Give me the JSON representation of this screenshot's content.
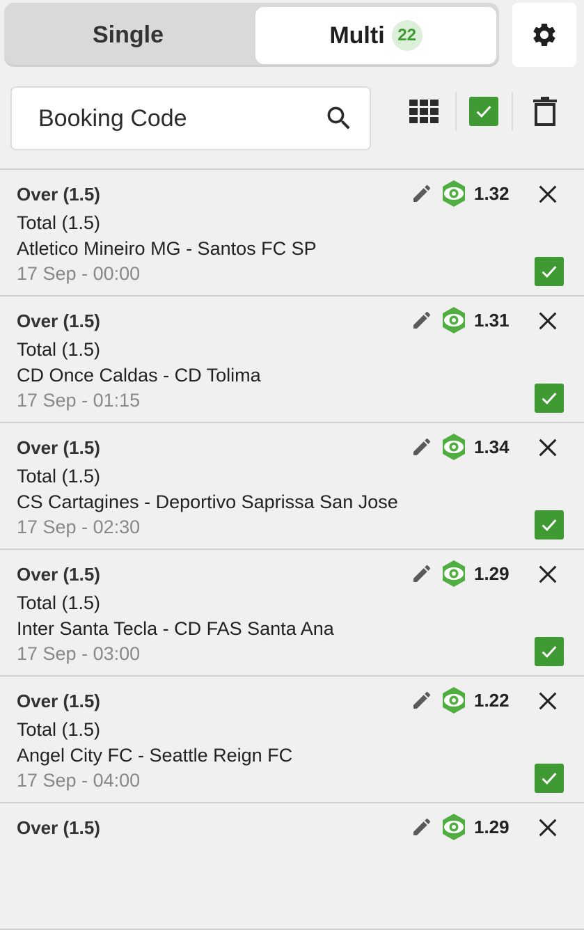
{
  "tabs": {
    "single_label": "Single",
    "multi_label": "Multi",
    "multi_count": "22"
  },
  "icons": {
    "settings": "gear-icon",
    "search": "search-icon",
    "grid": "grid-icon",
    "select_all": "checkbox-checked-icon",
    "delete": "trash-icon",
    "edit": "pencil-icon",
    "live": "eye-icon",
    "remove": "close-icon"
  },
  "colors": {
    "accent": "#3f9a33",
    "badge_bg": "#dcefd9"
  },
  "search": {
    "placeholder": "Booking Code"
  },
  "bets": [
    {
      "pick": "Over (1.5)",
      "market": "Total (1.5)",
      "match": "Atletico Mineiro MG - Santos FC SP",
      "time": "17 Sep - 00:00",
      "odds": "1.32",
      "checked": true
    },
    {
      "pick": "Over (1.5)",
      "market": "Total (1.5)",
      "match": "CD Once Caldas - CD Tolima",
      "time": "17 Sep - 01:15",
      "odds": "1.31",
      "checked": true
    },
    {
      "pick": "Over (1.5)",
      "market": "Total (1.5)",
      "match": "CS Cartagines - Deportivo Saprissa San Jose",
      "time": "17 Sep - 02:30",
      "odds": "1.34",
      "checked": true
    },
    {
      "pick": "Over (1.5)",
      "market": "Total (1.5)",
      "match": "Inter Santa Tecla - CD FAS Santa Ana",
      "time": "17 Sep - 03:00",
      "odds": "1.29",
      "checked": true
    },
    {
      "pick": "Over (1.5)",
      "market": "Total (1.5)",
      "match": "Angel City FC - Seattle Reign FC",
      "time": "17 Sep - 04:00",
      "odds": "1.22",
      "checked": true
    },
    {
      "pick": "Over (1.5)",
      "market": "",
      "match": "",
      "time": "",
      "odds": "1.29",
      "checked": false
    }
  ]
}
